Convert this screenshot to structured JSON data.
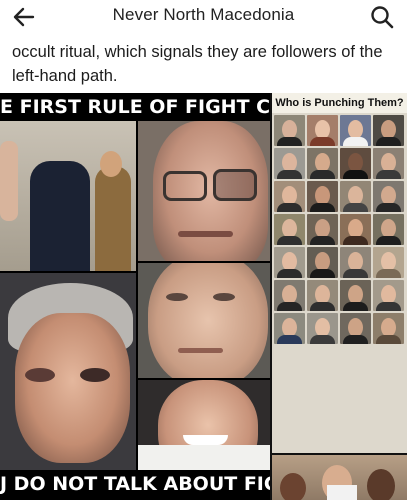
{
  "header": {
    "title": "Never North Macedonia",
    "back_icon": "arrow-left-icon",
    "search_icon": "search-icon"
  },
  "post": {
    "text": "occult ritual, which signals they are followers of the left-hand path."
  },
  "meme": {
    "top_text": "E FIRST RULE OF FIGHT CLUB",
    "bottom_text": "J DO NOT TALK ABOUT FIGHT CLU"
  },
  "collage": {
    "title": "Who is Punching Them?"
  },
  "colors": {
    "text": "#1c1c1c",
    "banner_bg": "#000000",
    "banner_text": "#ffffff"
  }
}
